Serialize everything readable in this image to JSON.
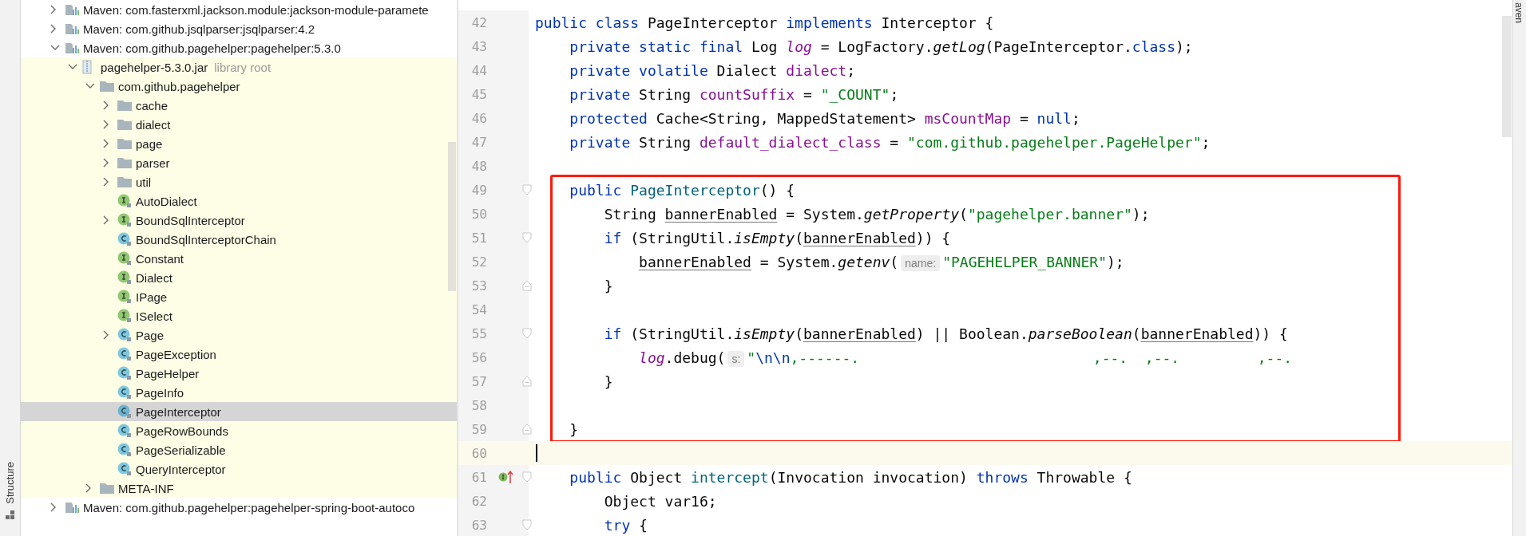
{
  "tool_strips": {
    "left_label": "Structure",
    "right_label": "aven"
  },
  "project_tree": [
    {
      "label": "Maven: com.fasterxml.jackson.module:jackson-module-paramete",
      "kind": "library",
      "expanded": false,
      "selected": false,
      "in_library": false
    },
    {
      "label": "Maven: com.github.jsqlparser:jsqlparser:4.2",
      "kind": "library",
      "expanded": false,
      "selected": false,
      "in_library": false
    },
    {
      "label": "Maven: com.github.pagehelper:pagehelper:5.3.0",
      "kind": "library",
      "expanded": true,
      "selected": false,
      "in_library": false,
      "children": [
        {
          "label": "pagehelper-5.3.0.jar",
          "hint": "library root",
          "kind": "jar",
          "expanded": true,
          "selected": false,
          "in_library": true,
          "children": [
            {
              "label": "com.github.pagehelper",
              "kind": "package",
              "expanded": true,
              "selected": false,
              "in_library": true,
              "children": [
                {
                  "label": "cache",
                  "kind": "folder",
                  "expanded": false,
                  "selected": false,
                  "in_library": true
                },
                {
                  "label": "dialect",
                  "kind": "folder",
                  "expanded": false,
                  "selected": false,
                  "in_library": true
                },
                {
                  "label": "page",
                  "kind": "folder",
                  "expanded": false,
                  "selected": false,
                  "in_library": true
                },
                {
                  "label": "parser",
                  "kind": "folder",
                  "expanded": false,
                  "selected": false,
                  "in_library": true
                },
                {
                  "label": "util",
                  "kind": "folder",
                  "expanded": false,
                  "selected": false,
                  "in_library": true
                },
                {
                  "label": "AutoDialect",
                  "kind": "interface",
                  "selected": false,
                  "in_library": true
                },
                {
                  "label": "BoundSqlInterceptor",
                  "kind": "interface",
                  "expanded": false,
                  "selected": false,
                  "in_library": true
                },
                {
                  "label": "BoundSqlInterceptorChain",
                  "kind": "class",
                  "selected": false,
                  "in_library": true
                },
                {
                  "label": "Constant",
                  "kind": "interface",
                  "selected": false,
                  "in_library": true
                },
                {
                  "label": "Dialect",
                  "kind": "interface",
                  "selected": false,
                  "in_library": true
                },
                {
                  "label": "IPage",
                  "kind": "interface",
                  "selected": false,
                  "in_library": true
                },
                {
                  "label": "ISelect",
                  "kind": "interface",
                  "selected": false,
                  "in_library": true
                },
                {
                  "label": "Page",
                  "kind": "class",
                  "expanded": false,
                  "selected": false,
                  "in_library": true
                },
                {
                  "label": "PageException",
                  "kind": "class",
                  "selected": false,
                  "in_library": true
                },
                {
                  "label": "PageHelper",
                  "kind": "class",
                  "selected": false,
                  "in_library": true
                },
                {
                  "label": "PageInfo",
                  "kind": "class",
                  "selected": false,
                  "in_library": true
                },
                {
                  "label": "PageInterceptor",
                  "kind": "class",
                  "selected": true
                },
                {
                  "label": "PageRowBounds",
                  "kind": "class",
                  "selected": false,
                  "in_library": true
                },
                {
                  "label": "PageSerializable",
                  "kind": "class",
                  "selected": false,
                  "in_library": true
                },
                {
                  "label": "QueryInterceptor",
                  "kind": "class",
                  "selected": false,
                  "in_library": true
                }
              ]
            },
            {
              "label": "META-INF",
              "kind": "package",
              "expanded": false,
              "selected": false,
              "in_library": true
            }
          ]
        }
      ]
    },
    {
      "label": "Maven: com.github.pagehelper:pagehelper-spring-boot-autoco",
      "kind": "library",
      "expanded": false,
      "selected": false,
      "in_library": false
    }
  ],
  "editor": {
    "lines": [
      {
        "number": "42",
        "fold_start": false,
        "fold_end": false,
        "implements_marker": false,
        "boxed": false,
        "current": false,
        "tokens": [
          {
            "kind": "kw",
            "text": "public class "
          },
          {
            "kind": "plain",
            "text": "PageInterceptor "
          },
          {
            "kind": "kw",
            "text": "implements "
          },
          {
            "kind": "plain",
            "text": "Interceptor {"
          }
        ]
      },
      {
        "number": "43",
        "fold_start": false,
        "fold_end": false,
        "implements_marker": false,
        "boxed": false,
        "current": false,
        "tokens": [
          {
            "kind": "kw",
            "text": "    private static final "
          },
          {
            "kind": "plain",
            "text": "Log "
          },
          {
            "kind": "static_field",
            "text": "log"
          },
          {
            "kind": "plain",
            "text": " = LogFactory."
          },
          {
            "kind": "static_call",
            "text": "getLog"
          },
          {
            "kind": "plain",
            "text": "(PageInterceptor."
          },
          {
            "kind": "kw",
            "text": "class"
          },
          {
            "kind": "plain",
            "text": ");"
          }
        ]
      },
      {
        "number": "44",
        "fold_start": false,
        "fold_end": false,
        "implements_marker": false,
        "boxed": false,
        "current": false,
        "tokens": [
          {
            "kind": "kw",
            "text": "    private volatile "
          },
          {
            "kind": "plain",
            "text": "Dialect "
          },
          {
            "kind": "field",
            "text": "dialect"
          },
          {
            "kind": "plain",
            "text": ";"
          }
        ]
      },
      {
        "number": "45",
        "fold_start": false,
        "fold_end": false,
        "implements_marker": false,
        "boxed": false,
        "current": false,
        "tokens": [
          {
            "kind": "kw",
            "text": "    private "
          },
          {
            "kind": "plain",
            "text": "String "
          },
          {
            "kind": "field",
            "text": "countSuffix"
          },
          {
            "kind": "plain",
            "text": " = "
          },
          {
            "kind": "str",
            "text": "\"_COUNT\""
          },
          {
            "kind": "plain",
            "text": ";"
          }
        ]
      },
      {
        "number": "46",
        "fold_start": false,
        "fold_end": false,
        "implements_marker": false,
        "boxed": false,
        "current": false,
        "tokens": [
          {
            "kind": "kw",
            "text": "    protected "
          },
          {
            "kind": "plain",
            "text": "Cache<String, MappedStatement> "
          },
          {
            "kind": "field",
            "text": "msCountMap"
          },
          {
            "kind": "plain",
            "text": " = "
          },
          {
            "kind": "kw",
            "text": "null"
          },
          {
            "kind": "plain",
            "text": ";"
          }
        ]
      },
      {
        "number": "47",
        "fold_start": false,
        "fold_end": false,
        "implements_marker": false,
        "boxed": false,
        "current": false,
        "tokens": [
          {
            "kind": "kw",
            "text": "    private "
          },
          {
            "kind": "plain",
            "text": "String "
          },
          {
            "kind": "field",
            "text": "default_dialect_class"
          },
          {
            "kind": "plain",
            "text": " = "
          },
          {
            "kind": "str",
            "text": "\"com.github.pagehelper.PageHelper\""
          },
          {
            "kind": "plain",
            "text": ";"
          }
        ]
      },
      {
        "number": "48",
        "fold_start": false,
        "fold_end": false,
        "implements_marker": false,
        "boxed": false,
        "current": false
      },
      {
        "number": "49",
        "fold_start": true,
        "fold_end": false,
        "implements_marker": false,
        "boxed": true,
        "current": false,
        "tokens": [
          {
            "kind": "kw",
            "text": "    public "
          },
          {
            "kind": "decl",
            "text": "PageInterceptor"
          },
          {
            "kind": "plain",
            "text": "() {"
          }
        ]
      },
      {
        "number": "50",
        "fold_start": false,
        "fold_end": false,
        "implements_marker": false,
        "boxed": true,
        "current": false,
        "tokens": [
          {
            "kind": "plain",
            "text": "        String "
          },
          {
            "kind": "local",
            "text": "bannerEnabled"
          },
          {
            "kind": "plain",
            "text": " = System."
          },
          {
            "kind": "static_call",
            "text": "getProperty"
          },
          {
            "kind": "plain",
            "text": "("
          },
          {
            "kind": "str",
            "text": "\"pagehelper.banner\""
          },
          {
            "kind": "plain",
            "text": ");"
          }
        ]
      },
      {
        "number": "51",
        "fold_start": true,
        "fold_end": false,
        "implements_marker": false,
        "boxed": true,
        "current": false,
        "tokens": [
          {
            "kind": "kw",
            "text": "        if "
          },
          {
            "kind": "plain",
            "text": "(StringUtil."
          },
          {
            "kind": "static_call",
            "text": "isEmpty"
          },
          {
            "kind": "plain",
            "text": "("
          },
          {
            "kind": "local",
            "text": "bannerEnabled"
          },
          {
            "kind": "plain",
            "text": ")) {"
          }
        ]
      },
      {
        "number": "52",
        "fold_start": false,
        "fold_end": false,
        "implements_marker": false,
        "boxed": true,
        "current": false,
        "tokens": [
          {
            "kind": "local",
            "text": "            bannerEnabled"
          },
          {
            "kind": "plain",
            "text": " = System."
          },
          {
            "kind": "static_call",
            "text": "getenv"
          },
          {
            "kind": "plain",
            "text": "("
          },
          {
            "kind": "hint",
            "text": "name:"
          },
          {
            "kind": "str",
            "text": "\"PAGEHELPER_BANNER\""
          },
          {
            "kind": "plain",
            "text": ");"
          }
        ]
      },
      {
        "number": "53",
        "fold_start": false,
        "fold_end": true,
        "implements_marker": false,
        "boxed": true,
        "current": false,
        "tokens": [
          {
            "kind": "plain",
            "text": "        }"
          }
        ]
      },
      {
        "number": "54",
        "fold_start": false,
        "fold_end": false,
        "implements_marker": false,
        "boxed": true,
        "current": false
      },
      {
        "number": "55",
        "fold_start": true,
        "fold_end": false,
        "implements_marker": false,
        "boxed": true,
        "current": false,
        "tokens": [
          {
            "kind": "kw",
            "text": "        if "
          },
          {
            "kind": "plain",
            "text": "(StringUtil."
          },
          {
            "kind": "static_call",
            "text": "isEmpty"
          },
          {
            "kind": "plain",
            "text": "("
          },
          {
            "kind": "local",
            "text": "bannerEnabled"
          },
          {
            "kind": "plain",
            "text": ") || Boolean."
          },
          {
            "kind": "static_call",
            "text": "parseBoolean"
          },
          {
            "kind": "plain",
            "text": "("
          },
          {
            "kind": "local",
            "text": "bannerEnabled"
          },
          {
            "kind": "plain",
            "text": ")) {"
          }
        ]
      },
      {
        "number": "56",
        "fold_start": false,
        "fold_end": false,
        "implements_marker": false,
        "boxed": true,
        "current": false,
        "tokens": [
          {
            "kind": "static_field",
            "text": "            log"
          },
          {
            "kind": "plain",
            "text": ".debug("
          },
          {
            "kind": "hint",
            "text": "s:"
          },
          {
            "kind": "str",
            "text": "\""
          },
          {
            "kind": "escape",
            "text": "\\n\\n"
          },
          {
            "kind": "str",
            "text": ",------.                           ,--.  ,--.         ,--."
          }
        ]
      },
      {
        "number": "57",
        "fold_start": false,
        "fold_end": true,
        "implements_marker": false,
        "boxed": true,
        "current": false,
        "tokens": [
          {
            "kind": "plain",
            "text": "        }"
          }
        ]
      },
      {
        "number": "58",
        "fold_start": false,
        "fold_end": false,
        "implements_marker": false,
        "boxed": true,
        "current": false
      },
      {
        "number": "59",
        "fold_start": false,
        "fold_end": true,
        "implements_marker": false,
        "boxed": true,
        "current": false,
        "tokens": [
          {
            "kind": "plain",
            "text": "    }"
          }
        ]
      },
      {
        "number": "60",
        "fold_start": false,
        "fold_end": false,
        "implements_marker": false,
        "boxed": false,
        "current": true
      },
      {
        "number": "61",
        "fold_start": true,
        "fold_end": false,
        "implements_marker": true,
        "boxed": false,
        "current": false,
        "tokens": [
          {
            "kind": "kw",
            "text": "    public "
          },
          {
            "kind": "plain",
            "text": "Object "
          },
          {
            "kind": "decl",
            "text": "intercept"
          },
          {
            "kind": "plain",
            "text": "(Invocation invocation) "
          },
          {
            "kind": "kw",
            "text": "throws "
          },
          {
            "kind": "plain",
            "text": "Throwable {"
          }
        ]
      },
      {
        "number": "62",
        "fold_start": false,
        "fold_end": false,
        "implements_marker": false,
        "boxed": false,
        "current": false,
        "tokens": [
          {
            "kind": "plain",
            "text": "        Object var16;"
          }
        ]
      },
      {
        "number": "63",
        "fold_start": true,
        "fold_end": false,
        "implements_marker": false,
        "boxed": false,
        "current": false,
        "tokens": [
          {
            "kind": "kw",
            "text": "        try "
          },
          {
            "kind": "plain",
            "text": "{"
          }
        ]
      }
    ]
  }
}
